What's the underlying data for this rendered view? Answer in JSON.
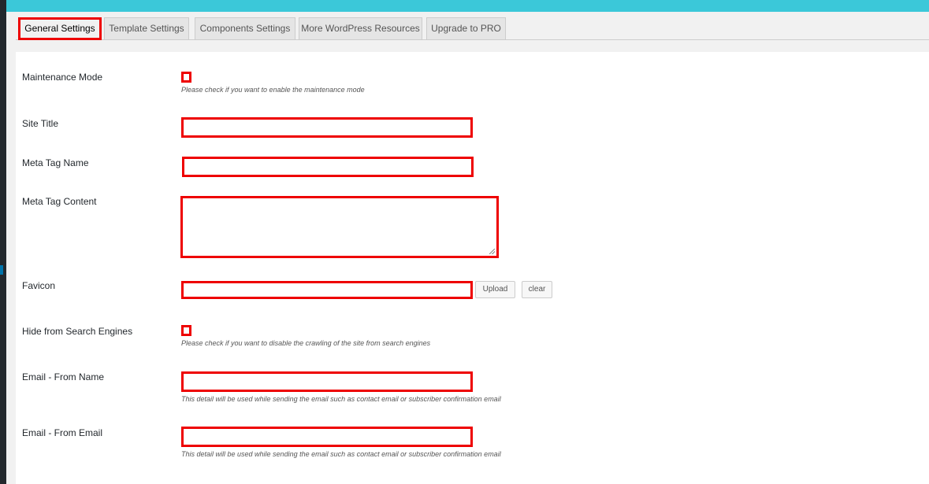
{
  "tabs": [
    "General Settings",
    "Template Settings",
    "Components Settings",
    "More WordPress Resources",
    "Upgrade to PRO"
  ],
  "fields": {
    "maintenance_mode": {
      "label": "Maintenance Mode",
      "checked": false,
      "desc": "Please check if you want to enable the maintenance mode"
    },
    "site_title": {
      "label": "Site Title",
      "value": ""
    },
    "meta_tag_name": {
      "label": "Meta Tag Name",
      "value": ""
    },
    "meta_tag_content": {
      "label": "Meta Tag Content",
      "value": ""
    },
    "favicon": {
      "label": "Favicon",
      "value": "",
      "upload": "Upload",
      "clear": "clear"
    },
    "hide_search": {
      "label": "Hide from Search Engines",
      "checked": false,
      "desc": "Please check if you want to disable the crawling of the site from search engines"
    },
    "email_from_name": {
      "label": "Email - From Name",
      "value": "",
      "desc": "This detail will be used while sending the email such as contact email or subscriber confirmation email"
    },
    "email_from_email": {
      "label": "Email - From Email",
      "value": "",
      "desc": "This detail will be used while sending the email such as contact email or subscriber confirmation email"
    }
  },
  "colors": {
    "topbar": "#3bc8d9",
    "highlight": "#ee0000"
  }
}
